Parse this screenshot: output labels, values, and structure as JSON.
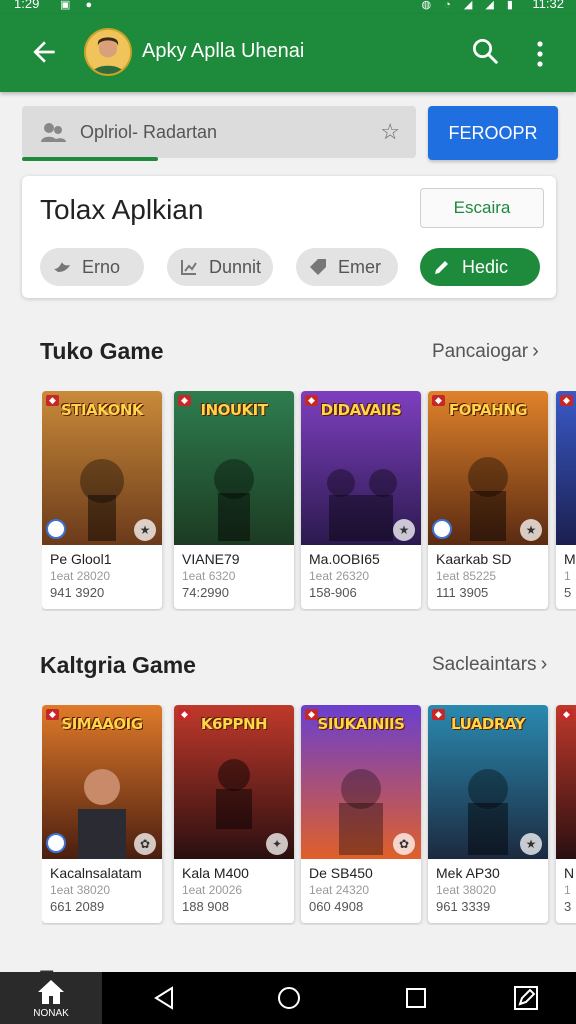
{
  "status": {
    "time_left": "1:29",
    "time_right": "11:32"
  },
  "appbar": {
    "title": "Apky Aplla Uhenai"
  },
  "search": {
    "value": "Oplriol-  Radartan",
    "button": "FEROOPR"
  },
  "card": {
    "title": "Tolax Aplkian",
    "action": "Escaira",
    "chips": [
      "Erno",
      "Dunnit",
      "Emer",
      "Hedic"
    ]
  },
  "sections": [
    {
      "title": "Tuko Game",
      "link": "Pancaiogar",
      "items": [
        {
          "art_title": "STIAKONK",
          "name": "Pe Glool1",
          "meta1": "1eat 28020",
          "meta2": "941 3920",
          "colors": [
            "#c98a3a",
            "#6b3a1a"
          ]
        },
        {
          "art_title": "INOUKIT",
          "name": "VIANE79",
          "meta1": "1eat 6320",
          "meta2": "74:2990",
          "colors": [
            "#2e7d4f",
            "#1c3b22"
          ]
        },
        {
          "art_title": "DIDAVAIIS",
          "name": "Ma.0OBI65",
          "meta1": "1eat 26320",
          "meta2": "158-906",
          "colors": [
            "#7e3fbf",
            "#2b1a4e"
          ]
        },
        {
          "art_title": "FOPAHNG",
          "name": "Kaarkab SD",
          "meta1": "1eat 85225",
          "meta2": "111 3905",
          "colors": [
            "#e0822a",
            "#5a2a12"
          ]
        },
        {
          "art_title": "",
          "name": "M",
          "meta1": "1",
          "meta2": "5",
          "colors": [
            "#3a5ac8",
            "#1a1f4e"
          ]
        }
      ]
    },
    {
      "title": "Kaltgria Game",
      "link": "Sacleaintars",
      "items": [
        {
          "art_title": "SIMAAOIG",
          "name": "Kacalnsalatam",
          "meta1": "1eat 38020",
          "meta2": "661 2089",
          "colors": [
            "#e07a2a",
            "#4a1e10"
          ]
        },
        {
          "art_title": "K6PPNH",
          "name": "Kala M400",
          "meta1": "1eat 20026",
          "meta2": "188 908",
          "colors": [
            "#c0392b",
            "#2a0f10"
          ]
        },
        {
          "art_title": "SIUKAINIIS",
          "name": "De SB450",
          "meta1": "1eat 24320",
          "meta2": "060 4908",
          "colors": [
            "#6a3fcf",
            "#e0602a"
          ]
        },
        {
          "art_title": "LUADRAY",
          "name": "Mek AP30",
          "meta1": "1eat 38020",
          "meta2": "961 3339",
          "colors": [
            "#2a8ab0",
            "#1c2a40"
          ]
        },
        {
          "art_title": "",
          "name": "N",
          "meta1": "1",
          "meta2": "3",
          "colors": [
            "#c0392b",
            "#2a0f10"
          ]
        }
      ]
    }
  ],
  "peek_text": "Tu",
  "nav": {
    "home_label": "NONAK"
  }
}
